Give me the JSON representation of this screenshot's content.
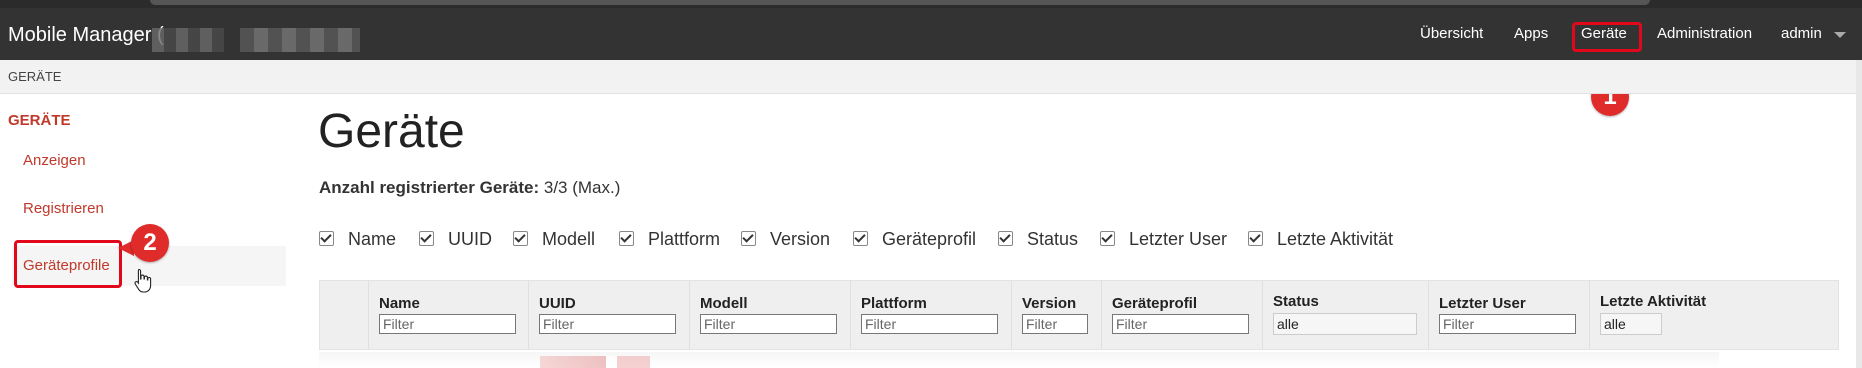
{
  "app": {
    "brand": "Mobile Manager ("
  },
  "navbar": {
    "items": [
      {
        "label": "Übersicht"
      },
      {
        "label": "Apps"
      },
      {
        "label": "Geräte",
        "active": true
      },
      {
        "label": "Administration"
      },
      {
        "label": "admin"
      }
    ]
  },
  "breadcrumb": {
    "current": "GERÄTE"
  },
  "sidebar": {
    "title": "GERÄTE",
    "items": [
      {
        "label": "Anzeigen"
      },
      {
        "label": "Registrieren"
      },
      {
        "label": "Geräteprofile",
        "selected": true
      }
    ]
  },
  "annotations": {
    "step1": "1",
    "step2": "2",
    "color": "#e02b2b"
  },
  "main": {
    "title": "Geräte",
    "count_label": "Anzahl registrierter Geräte:",
    "count_value": "3/3 (Max.)",
    "column_toggles": [
      {
        "label": "Name",
        "checked": true
      },
      {
        "label": "UUID",
        "checked": true
      },
      {
        "label": "Modell",
        "checked": true
      },
      {
        "label": "Plattform",
        "checked": true
      },
      {
        "label": "Version",
        "checked": true
      },
      {
        "label": "Geräteprofil",
        "checked": true
      },
      {
        "label": "Status",
        "checked": true
      },
      {
        "label": "Letzter User",
        "checked": true
      },
      {
        "label": "Letzte Aktivität",
        "checked": true
      }
    ],
    "table": {
      "columns": [
        {
          "label": "Name",
          "filter_placeholder": "Filter"
        },
        {
          "label": "UUID",
          "filter_placeholder": "Filter"
        },
        {
          "label": "Modell",
          "filter_placeholder": "Filter"
        },
        {
          "label": "Plattform",
          "filter_placeholder": "Filter"
        },
        {
          "label": "Version",
          "filter_placeholder": "Filter"
        },
        {
          "label": "Geräteprofil",
          "filter_placeholder": "Filter"
        },
        {
          "label": "Status",
          "filter_value": "alle"
        },
        {
          "label": "Letzter User",
          "filter_placeholder": "Filter"
        },
        {
          "label": "Letzte Aktivität",
          "filter_value": "alle"
        }
      ]
    }
  },
  "colors": {
    "navbar": "#333333",
    "accent": "#c0392b",
    "highlight": "#e0081a"
  }
}
